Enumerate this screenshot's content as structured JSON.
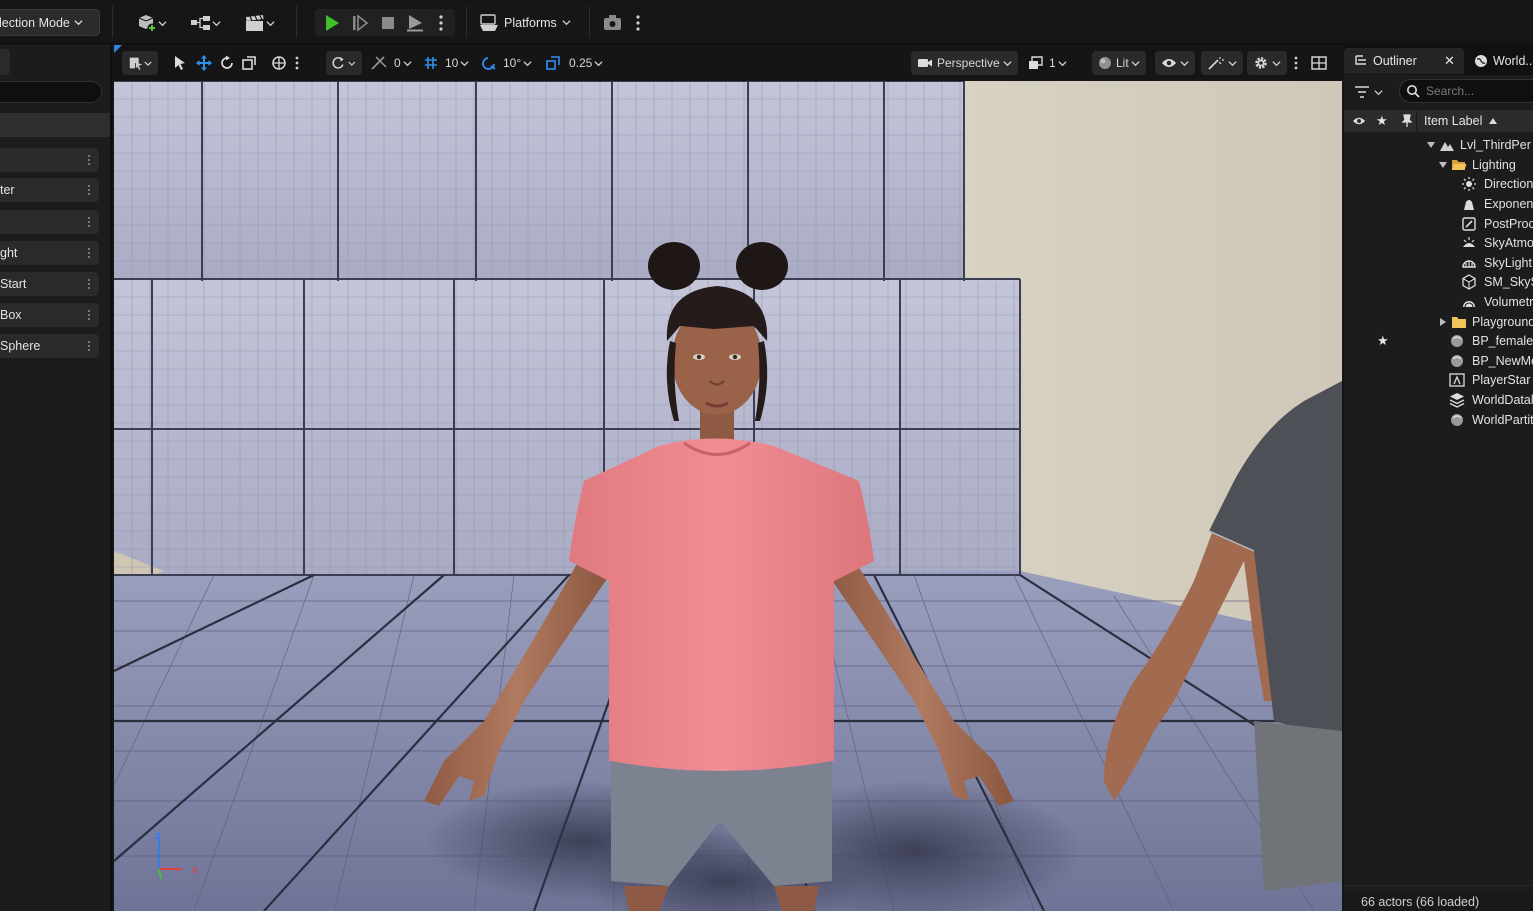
{
  "toolbar": {
    "mode_label": "lection Mode",
    "platforms_label": "Platforms"
  },
  "left_panel": {
    "items": [
      {
        "label": ""
      },
      {
        "label": "ter"
      },
      {
        "label": ""
      },
      {
        "label": "ght"
      },
      {
        "label": "Start"
      },
      {
        "label": "Box"
      },
      {
        "label": "Sphere"
      }
    ]
  },
  "viewport": {
    "translate_snap": "0",
    "grid_snap": "10",
    "rotate_snap": "10°",
    "scale_snap": "0.25",
    "view_mode": "Perspective",
    "camera_speed": "1",
    "lighting_mode": "Lit",
    "axis_x": "x",
    "axis_z": "z"
  },
  "outliner": {
    "tab_outliner": "Outliner",
    "tab_world": "World..",
    "search_placeholder": "Search...",
    "column_label": "Item Label",
    "rows": [
      {
        "label": "Lvl_ThirdPer",
        "icon": "level-icon"
      },
      {
        "label": "Lighting",
        "icon": "folder-open-icon"
      },
      {
        "label": "Direction",
        "icon": "directional-light-icon"
      },
      {
        "label": "Exponen",
        "icon": "fog-icon"
      },
      {
        "label": "PostProc",
        "icon": "postprocess-icon"
      },
      {
        "label": "SkyAtmo",
        "icon": "sky-atmosphere-icon"
      },
      {
        "label": "SkyLight",
        "icon": "sky-light-icon"
      },
      {
        "label": "SM_SkyS",
        "icon": "static-mesh-icon"
      },
      {
        "label": "Volumetr",
        "icon": "volumetric-cloud-icon"
      },
      {
        "label": "Playground",
        "icon": "folder-icon"
      },
      {
        "label": "BP_female_",
        "icon": "actor-icon"
      },
      {
        "label": "BP_NewMe",
        "icon": "actor-icon"
      },
      {
        "label": "PlayerStar",
        "icon": "player-start-icon"
      },
      {
        "label": "WorldDatal",
        "icon": "data-layer-icon"
      },
      {
        "label": "WorldPartit",
        "icon": "actor-icon"
      }
    ],
    "footer": "66 actors (66 loaded)"
  }
}
